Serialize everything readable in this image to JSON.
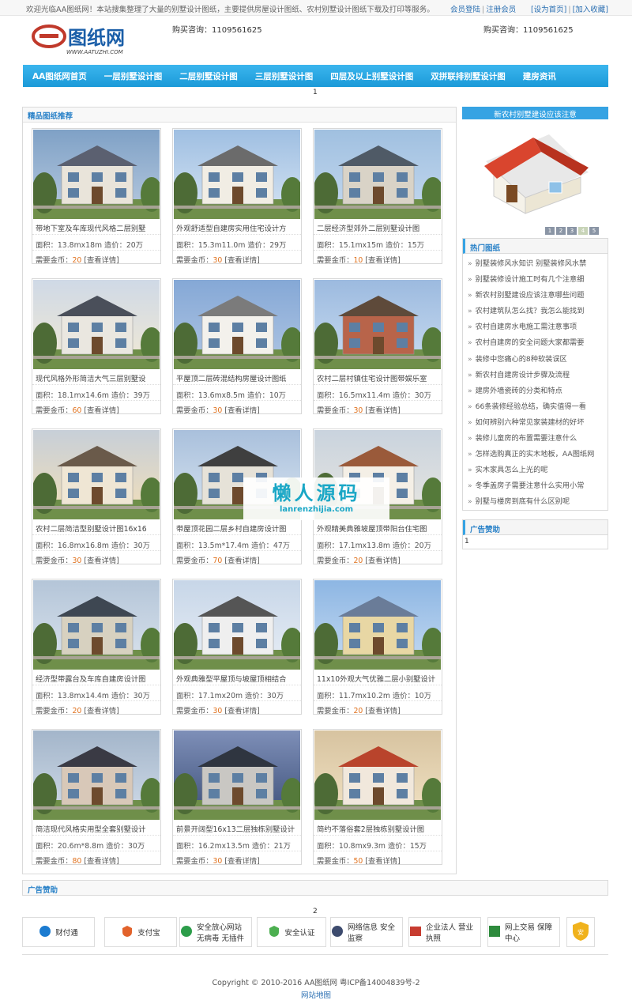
{
  "topbar": {
    "welcome": "欢迎光临AA图纸网！本站搜集整理了大量的别墅设计图纸，主要提供房屋设计图纸、农村别墅设计图纸下载及打印等服务。",
    "login": "会员登陆",
    "register": "注册会员",
    "set_home": "[设为首页]",
    "bookmark": "[加入收藏]"
  },
  "header": {
    "logo_text": "图纸网",
    "logo_url_text": "WWW.AATUZHI.COM",
    "hotline_left": "购买咨询：1109561625",
    "hotline_right": "购买咨询：1109561625"
  },
  "nav": {
    "items": [
      "AA图纸网首页",
      "一层别墅设计图",
      "二层别墅设计图",
      "三层别墅设计图",
      "四层及以上别墅设计图",
      "双拼联排别墅设计图",
      "建房资讯"
    ]
  },
  "marker_top": "1",
  "marker_bottom": "2",
  "main": {
    "heading": "精品图纸推荐",
    "spec_label": "面积：",
    "cost_label": " 造价：",
    "coin_label": "需要金币：",
    "detail_label": "[查看详情]",
    "cards": [
      {
        "title": "带地下室及车库现代风格二层别墅",
        "area": "13.8mx18m",
        "cost": "20万",
        "coins": "20"
      },
      {
        "title": "外观舒适型自建房实用住宅设计方",
        "area": "15.3m11.0m",
        "cost": "29万",
        "coins": "30"
      },
      {
        "title": "二层经济型郊外二层别墅设计图",
        "area": "15.1mx15m",
        "cost": "15万",
        "coins": "10"
      },
      {
        "title": "现代风格外形简洁大气三层别墅设",
        "area": "18.1mx14.6m",
        "cost": "39万",
        "coins": "60"
      },
      {
        "title": "平屋顶二层砖混结构房屋设计图纸",
        "area": "13.6mx8.5m",
        "cost": "10万",
        "coins": "30"
      },
      {
        "title": "农村二层村镇住宅设计图带娱乐室",
        "area": "16.5mx11.4m",
        "cost": "30万",
        "coins": "30"
      },
      {
        "title": "农村二层简洁型别墅设计图16x16",
        "area": "16.8mx16.8m",
        "cost": "30万",
        "coins": "30"
      },
      {
        "title": "带屋顶花园二层乡村自建房设计图",
        "area": "13.5m*17.4m",
        "cost": "47万",
        "coins": "70"
      },
      {
        "title": "外观精美典雅坡屋顶带阳台住宅图",
        "area": "17.1mx13.8m",
        "cost": "20万",
        "coins": "20"
      },
      {
        "title": "经济型带露台及车库自建房设计图",
        "area": "13.8mx14.4m",
        "cost": "30万",
        "coins": "20"
      },
      {
        "title": "外观典雅型平屋顶与坡屋顶相结合",
        "area": "17.1mx20m",
        "cost": "30万",
        "coins": "30"
      },
      {
        "title": "11x10外观大气优雅二层小别墅设计",
        "area": "11.7mx10.2m",
        "cost": "10万",
        "coins": "20"
      },
      {
        "title": "简洁现代风格实用型全套别墅设计",
        "area": "20.6m*8.8m",
        "cost": "30万",
        "coins": "80"
      },
      {
        "title": "前景开阔型16x13二层独栋别墅设计",
        "area": "16.2mx13.5m",
        "cost": "21万",
        "coins": "30"
      },
      {
        "title": "简约不落俗套2层独栋别墅设计图",
        "area": "10.8mx9.3m",
        "cost": "15万",
        "coins": "50"
      }
    ]
  },
  "sidebar": {
    "notice_heading": "新农村别墅建设应该注意",
    "slider_pages": [
      "1",
      "2",
      "3",
      "4",
      "5"
    ],
    "hot_heading": "热门图纸",
    "hot_items": [
      "别墅装修风水知识 别墅装修风水禁",
      "别墅装修设计施工时有几个注意细",
      "新农村别墅建设应该注意哪些问题",
      "农村建筑队怎么找？我怎么能找到",
      "农村自建房水电施工需注意事项",
      "农村自建房的安全问题大家都需要",
      "装修中您痛心的8种软装误区",
      "新农村自建房设计步骤及流程",
      "建房外墙瓷砖的分类和特点",
      "66条装修经验总结，确实值得一看",
      "如何辨别六种常见家装建材的好坏",
      "装修儿童房的布置需要注意什么",
      "怎样选购真正的实木地板，AA图纸网",
      "实木家具怎么上光的呢",
      "冬季盖房子需要注意什么实用小常",
      "别墅与楼房到底有什么区别呢"
    ],
    "ad_heading": "广告赞助",
    "ad_number": "1"
  },
  "bottom_ad": {
    "heading": "广告赞助"
  },
  "badges": [
    {
      "label": "财付通",
      "icon": "tenpay-icon"
    },
    {
      "label": "支付宝",
      "icon": "alipay-icon"
    },
    {
      "label": "安全放心网站 无病毒 无插件",
      "icon": "safe-site-icon"
    },
    {
      "label": "安全认证",
      "icon": "security-cert-icon"
    },
    {
      "label": "网络信息 安全监察",
      "icon": "police-icon"
    },
    {
      "label": "企业法人 营业执照",
      "icon": "license-icon"
    },
    {
      "label": "网上交易 保障中心",
      "icon": "trade-guard-icon"
    },
    {
      "label": "安",
      "icon": "shield-icon"
    }
  ],
  "footer": {
    "copyright": "Copyright © 2010-2016 AA图纸网   粤ICP备14004839号-2",
    "sitemap": "网站地图"
  },
  "watermark": {
    "cn": "懒人源码",
    "en": "lanrenzhijia.com"
  }
}
